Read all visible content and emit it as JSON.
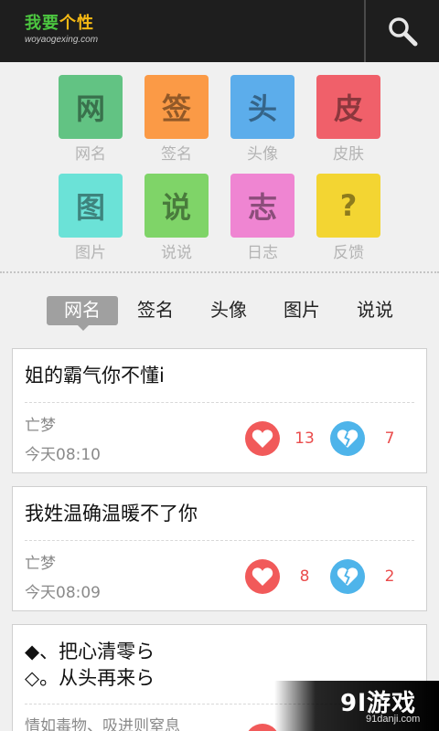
{
  "app": {
    "title_part1": "我要",
    "title_part2": "个性",
    "subtitle": "woyaogexing.com"
  },
  "colors": {
    "header_bg": "#1e1e1e",
    "tile_green": "#62c383",
    "tile_orange": "#fb9a46",
    "tile_blue": "#5cadeb",
    "tile_red": "#f0606a",
    "tile_cyan": "#6be2d7",
    "tile_lime": "#7fd468",
    "tile_pink": "#ef85d2",
    "tile_yellow": "#f3d532"
  },
  "grid": {
    "items": [
      {
        "glyph": "网",
        "label": "网名"
      },
      {
        "glyph": "签",
        "label": "签名"
      },
      {
        "glyph": "头",
        "label": "头像"
      },
      {
        "glyph": "皮",
        "label": "皮肤"
      },
      {
        "glyph": "图",
        "label": "图片"
      },
      {
        "glyph": "说",
        "label": "说说"
      },
      {
        "glyph": "志",
        "label": "日志"
      },
      {
        "glyph": "?",
        "label": "反馈"
      }
    ]
  },
  "tabs": [
    {
      "label": "网名"
    },
    {
      "label": "签名"
    },
    {
      "label": "头像"
    },
    {
      "label": "图片"
    },
    {
      "label": "说说"
    }
  ],
  "posts": [
    {
      "text": "姐的霸气你不懂i",
      "author": "亡梦",
      "time": "今天08:10",
      "likes": "13",
      "dislikes": "7"
    },
    {
      "text": "我姓温确温暖不了你",
      "author": "亡梦",
      "time": "今天08:09",
      "likes": "8",
      "dislikes": "2"
    },
    {
      "line1": "◆、把心清零ら",
      "line2": "◇。从头再来ら",
      "author": "情如毒物、吸进则窒息"
    }
  ],
  "watermark": {
    "main": "9l游戏",
    "sub": "91danji.com"
  }
}
